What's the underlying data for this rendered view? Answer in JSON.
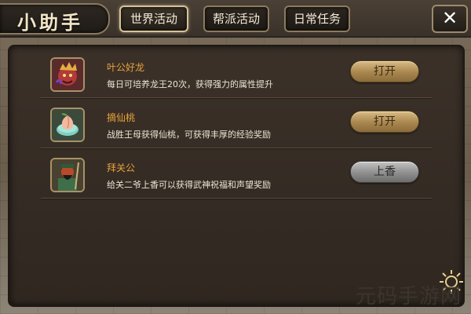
{
  "header": {
    "title": "小助手",
    "tabs": [
      {
        "label": "世界活动",
        "active": true
      },
      {
        "label": "帮派活动",
        "active": false
      },
      {
        "label": "日常任务",
        "active": false
      }
    ],
    "close_label": "✕"
  },
  "activities": [
    {
      "name": "叶公好龙",
      "desc": "每日可培养龙王20次，获得强力的属性提升",
      "button": "打开",
      "button_style": "gold",
      "icon": "dragon-king-icon"
    },
    {
      "name": "摘仙桃",
      "desc": "战胜王母获得仙桃，可获得丰厚的经验奖励",
      "button": "打开",
      "button_style": "gold",
      "icon": "peach-icon"
    },
    {
      "name": "拜关公",
      "desc": "给关二爷上香可以获得武神祝福和声望奖励",
      "button": "上香",
      "button_style": "grey",
      "icon": "guan-gong-icon"
    }
  ],
  "watermark": "元码手游网",
  "colors": {
    "accent_name": "#e8a23a",
    "button_gold": "#c2a46b",
    "button_grey": "#9a9a9a"
  }
}
